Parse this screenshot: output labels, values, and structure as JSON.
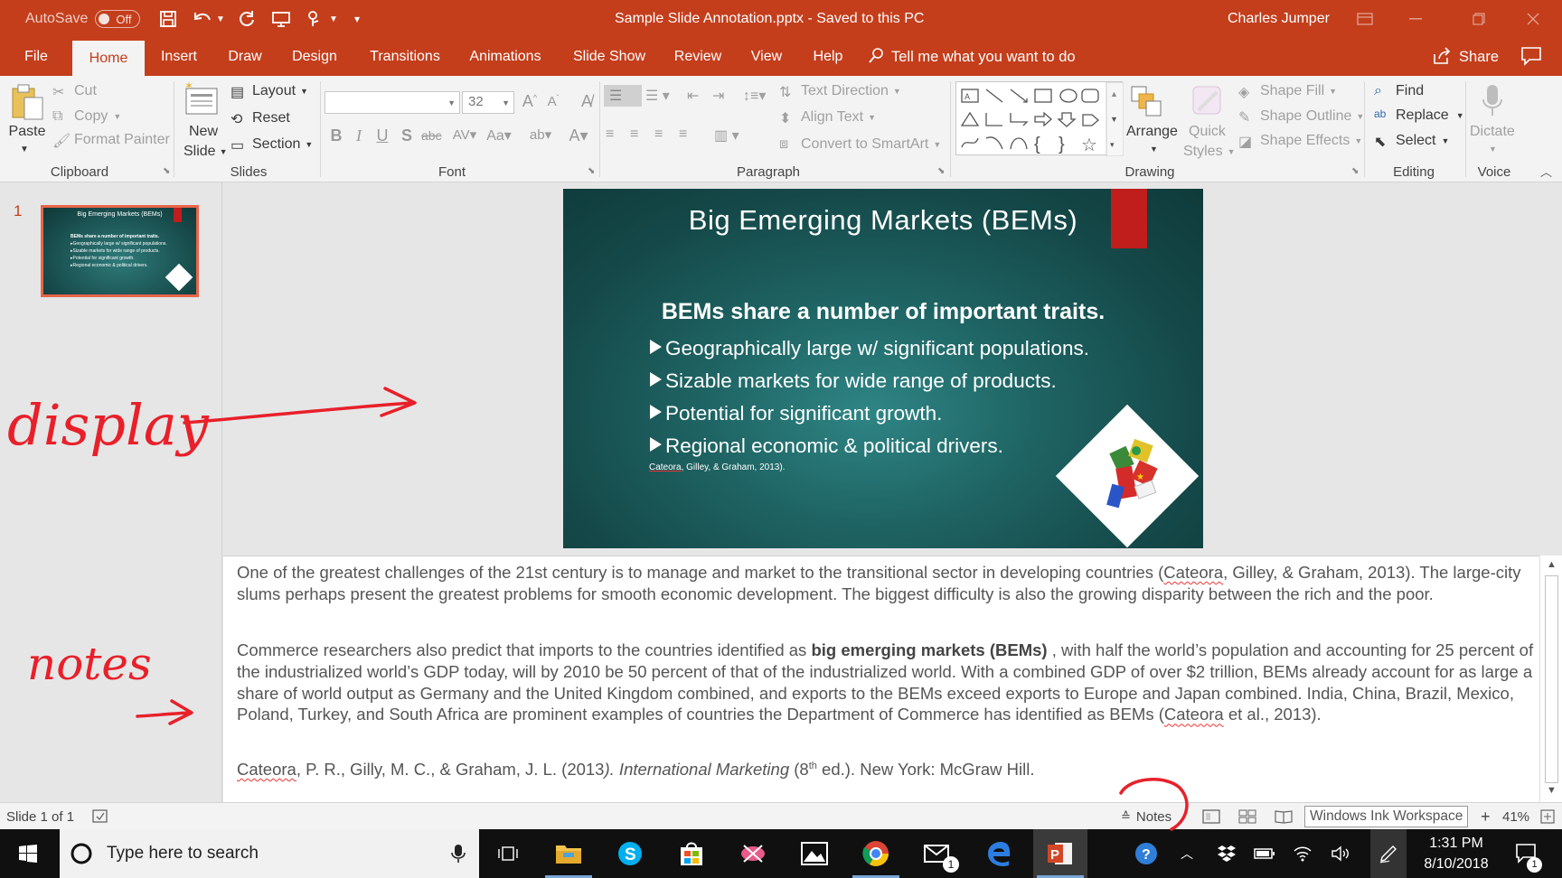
{
  "titlebar": {
    "autosave_label": "AutoSave",
    "autosave_state": "Off",
    "doc_title": "Sample Slide Annotation.pptx  -  Saved to this PC",
    "user_name": "Charles Jumper"
  },
  "tabs": [
    "File",
    "Home",
    "Insert",
    "Draw",
    "Design",
    "Transitions",
    "Animations",
    "Slide Show",
    "Review",
    "View",
    "Help"
  ],
  "active_tab": "Home",
  "tell_me": "Tell me what you want to do",
  "share_label": "Share",
  "ribbon": {
    "clipboard": {
      "paste": "Paste",
      "cut": "Cut",
      "copy": "Copy",
      "format_painter": "Format Painter",
      "label": "Clipboard"
    },
    "slides": {
      "new_slide_1": "New",
      "new_slide_2": "Slide",
      "layout": "Layout",
      "reset": "Reset",
      "section": "Section",
      "label": "Slides"
    },
    "font": {
      "font_name": "",
      "font_size": "32",
      "label": "Font"
    },
    "paragraph": {
      "text_direction": "Text Direction",
      "align_text": "Align Text",
      "smartart": "Convert to SmartArt",
      "label": "Paragraph"
    },
    "drawing": {
      "arrange": "Arrange",
      "quick_styles_1": "Quick",
      "quick_styles_2": "Styles",
      "shape_fill": "Shape Fill",
      "shape_outline": "Shape Outline",
      "shape_effects": "Shape Effects",
      "label": "Drawing"
    },
    "editing": {
      "find": "Find",
      "replace": "Replace",
      "select": "Select",
      "label": "Editing"
    },
    "voice": {
      "dictate": "Dictate",
      "label": "Voice"
    }
  },
  "thumbnail": {
    "number": "1",
    "title": "Big Emerging Markets (BEMs)",
    "lines": [
      "BEMs share a number of important traits.",
      "▸Geographically large w/ significant populations.",
      "▸Sizable markets for wide range of products.",
      "▸Potential for significant growth.",
      "▸Regional economic & political drivers."
    ]
  },
  "slide": {
    "title": "Big Emerging Markets (BEMs)",
    "subtitle": "BEMs share a number of important traits.",
    "bullets": [
      "Geographically large w/ significant populations.",
      "Sizable markets for wide range of products.",
      "Potential for significant growth.",
      "Regional economic & political drivers."
    ],
    "citation_author": "Cateora",
    "citation_rest": ", Gilley, & Graham, 2013)."
  },
  "notes": {
    "p1_a": "One of the greatest challenges of the 21st century is to manage and market to the transitional sector in developing countries (",
    "p1_cite": "Cateora",
    "p1_b": ", Gilley, & Graham, 2013). The large-city slums perhaps present the greatest problems for smooth economic development. The biggest difficulty is also the growing disparity between the rich and the poor.",
    "p2_a": "Commerce researchers also predict that imports to the countries identified as ",
    "p2_bold": "big emerging markets (BEMs)",
    "p2_b": " , with half the world’s population and accounting for 25 percent of the industrialized world’s GDP today, will by 2010 be 50 percent of that of the industrialized world. With a combined GDP of over $2 trillion, BEMs already account for as large a share of world output as Germany and the United Kingdom combined, and exports to the BEMs exceed exports to Europe and Japan combined. India, China, Brazil, Mexico, Poland, Turkey, and South Africa are prominent examples of countries the Department of Commerce has identified as BEMs (",
    "p2_cite": "Cateora",
    "p2_c": " et al., 2013).",
    "p3_cite": "Cateora",
    "p3_a": ", P. R., Gilly, M. C., & Graham, J. L. (2013",
    "p3_italic": "). International Marketing",
    "p3_b": " (8",
    "p3_sup": "th",
    "p3_c": " ed.). New York: McGraw Hill."
  },
  "statusbar": {
    "slide_count": "Slide 1 of 1",
    "notes_label": "Notes",
    "tooltip": "Windows Ink Workspace",
    "zoom": "41%"
  },
  "taskbar": {
    "search_placeholder": "Type here to search",
    "time": "1:31 PM",
    "date": "8/10/2018",
    "mail_badge": "1",
    "action_badge": "1"
  },
  "annotations": {
    "display_word": "display",
    "notes_word": "notes",
    "color": "#e8202a"
  }
}
